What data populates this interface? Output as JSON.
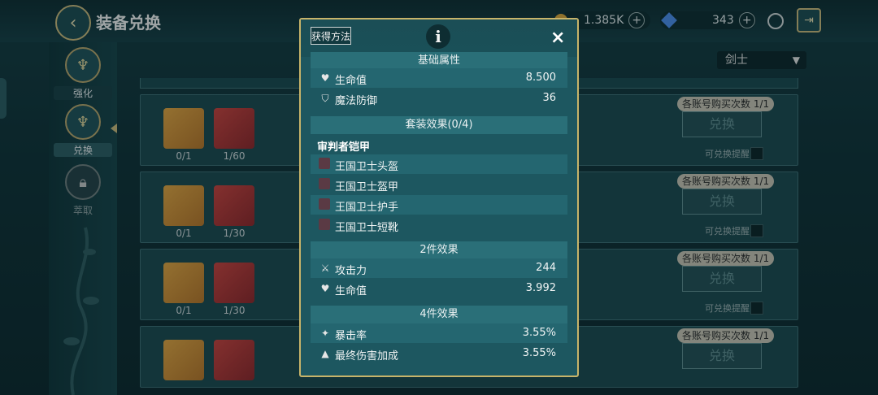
{
  "header": {
    "title": "装备兑换",
    "gold": "1.385K",
    "gems": "343"
  },
  "sidebar": {
    "items": [
      {
        "label": "强化"
      },
      {
        "label": "兑换"
      },
      {
        "label": "萃取"
      }
    ]
  },
  "class_filter": {
    "selected": "剑士"
  },
  "rows": [
    {
      "item_count": "0/1",
      "mat_count": "1/60",
      "limit": "各账号购买次数 1/1",
      "button": "兑换",
      "remind": "可兑换提醒"
    },
    {
      "item_count": "0/1",
      "mat_count": "1/30",
      "limit": "各账号购买次数 1/1",
      "button": "兑换",
      "remind": "可兑换提醒"
    },
    {
      "item_count": "0/1",
      "mat_count": "1/30",
      "limit": "各账号购买次数 1/1",
      "button": "兑换",
      "remind": "可兑换提醒"
    },
    {
      "item_count": "",
      "mat_count": "",
      "limit": "各账号购买次数 1/1",
      "button": "兑换",
      "remind": ""
    }
  ],
  "modal": {
    "get_method": "获得方法",
    "info_icon": "i",
    "close_icon": "×",
    "basic_title": "基础属性",
    "basic": [
      {
        "icon": "heart-icon",
        "label": "生命值",
        "value": "8.500"
      },
      {
        "icon": "shield-icon",
        "label": "魔法防御",
        "value": "36"
      }
    ],
    "set_title": "套装效果(0/4)",
    "set_name": "审判者铠甲",
    "set_parts": [
      "王国卫士头盔",
      "王国卫士盔甲",
      "王国卫士护手",
      "王国卫士短靴"
    ],
    "two_title": "2件效果",
    "two": [
      {
        "icon": "swords-icon",
        "label": "攻击力",
        "value": "244"
      },
      {
        "icon": "heart-icon",
        "label": "生命值",
        "value": "3.992"
      }
    ],
    "four_title": "4件效果",
    "four": [
      {
        "icon": "crit-icon",
        "label": "暴击率",
        "value": "3.55%"
      },
      {
        "icon": "damage-up-icon",
        "label": "最终伤害加成",
        "value": "3.55%"
      }
    ]
  }
}
